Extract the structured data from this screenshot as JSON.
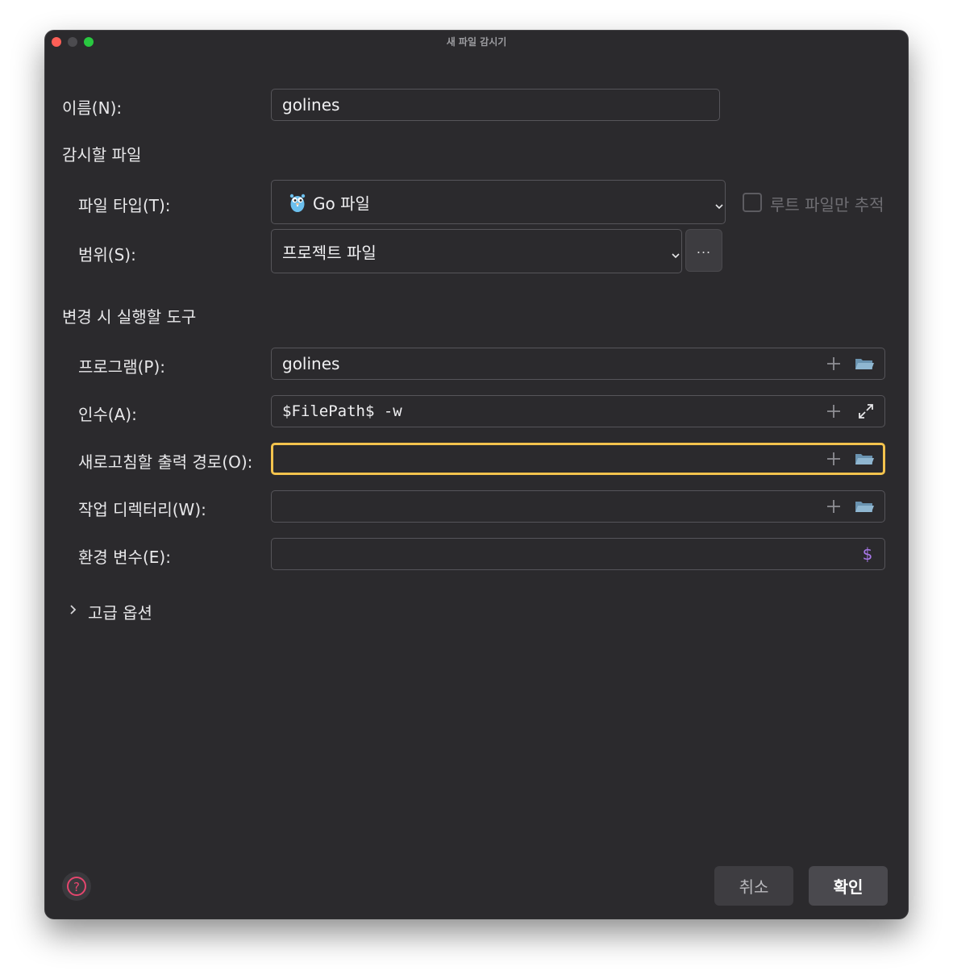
{
  "window": {
    "title": "새 파일 감시기"
  },
  "name_field": {
    "label": "이름(N):",
    "value": "golines"
  },
  "watch_section": {
    "title": "감시할 파일",
    "file_type": {
      "label": "파일 타입(T):",
      "value": "Go 파일",
      "icon": "go-gopher-icon"
    },
    "root_only": {
      "label": "루트 파일만 추적",
      "checked": false
    },
    "scope": {
      "label": "범위(S):",
      "value": "프로젝트 파일",
      "more_label": "..."
    }
  },
  "tool_section": {
    "title": "변경 시 실행할 도구",
    "program": {
      "label": "프로그램(P):",
      "value": "golines"
    },
    "arguments": {
      "label": "인수(A):",
      "value": "$FilePath$ -w"
    },
    "output_paths": {
      "label": "새로고침할 출력 경로(O):",
      "value": ""
    },
    "working_dir": {
      "label": "작업 디렉터리(W):",
      "value": ""
    },
    "env_vars": {
      "label": "환경 변수(E):",
      "value": ""
    }
  },
  "advanced": {
    "label": "고급 옵션",
    "expanded": false
  },
  "footer": {
    "cancel_label": "취소",
    "ok_label": "확인"
  },
  "colors": {
    "background": "#2b2a2d",
    "focus_border": "#f3c34d",
    "help_icon": "#e5466e",
    "folder_icon": "#8fb6d0",
    "env_icon": "#a878e8"
  }
}
